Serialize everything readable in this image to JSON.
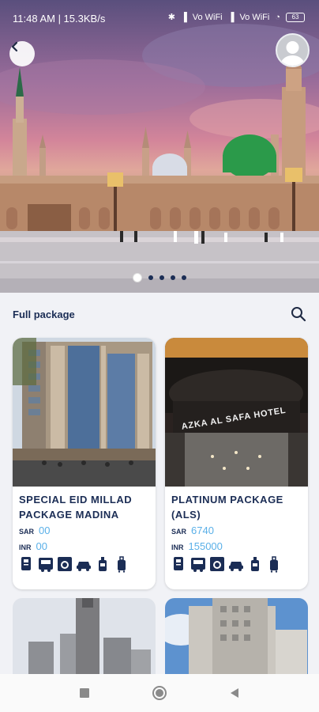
{
  "status": {
    "time": "11:48 AM | 15.3KB/s",
    "net1": "Vo WiFi",
    "net2": "Vo WiFi",
    "battery": "63"
  },
  "hero": {
    "slides": 5,
    "active_slide": 0
  },
  "section": {
    "title": "Full package"
  },
  "packages": [
    {
      "name": "SPECIAL EID MILLAD PACKAGE MADINA",
      "sar_label": "SAR",
      "sar_value": "00",
      "inr_label": "INR",
      "inr_value": "00"
    },
    {
      "name": "PLATINUM PACKAGE (ALS)",
      "sar_label": "SAR",
      "sar_value": "6740",
      "inr_label": "INR",
      "inr_value": "155000",
      "hotel_sign": "AZKA AL SAFA HOTEL"
    }
  ],
  "amenities": [
    "visa-icon",
    "bus-icon",
    "washing-machine-icon",
    "car-icon",
    "bottle-icon",
    "luggage-icon"
  ],
  "colors": {
    "accent": "#5ab0e8",
    "navy": "#1b2d55"
  }
}
